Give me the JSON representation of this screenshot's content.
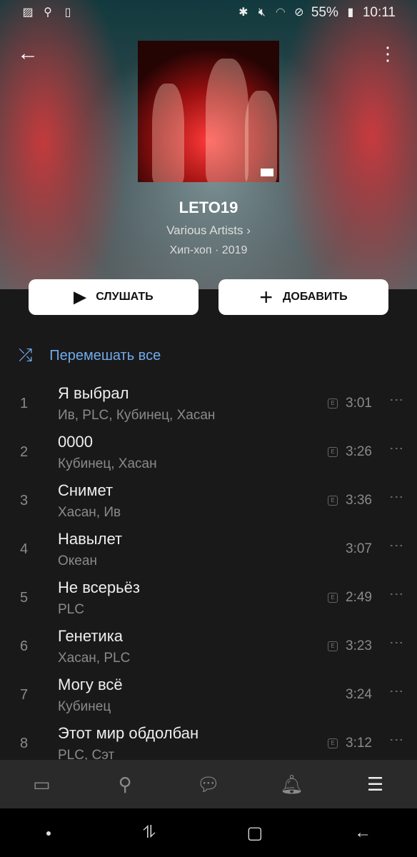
{
  "status": {
    "battery": "55%",
    "time": "10:11",
    "icons_left": [
      "gallery-icon",
      "search-icon",
      "screen-record-icon"
    ],
    "icons_right": [
      "bluetooth-icon",
      "mute-icon",
      "wifi-icon",
      "dnd-icon",
      "battery-icon"
    ]
  },
  "album": {
    "title": "LETO19",
    "artist": "Various Artists",
    "genre_year": "Хип-хоп · 2019"
  },
  "actions": {
    "play": "СЛУШАТЬ",
    "add": "ДОБАВИТЬ",
    "shuffle": "Перемешать все"
  },
  "colors": {
    "accent": "#71aaeb",
    "background": "#191919"
  },
  "tracks": [
    {
      "num": "1",
      "title": "Я выбрал",
      "artists": "Ив, PLC, Кубинец, Хасан",
      "explicit": true,
      "duration": "3:01"
    },
    {
      "num": "2",
      "title": "0000",
      "artists": "Кубинец, Хасан",
      "explicit": true,
      "duration": "3:26"
    },
    {
      "num": "3",
      "title": "Снимет",
      "artists": "Хасан, Ив",
      "explicit": true,
      "duration": "3:36"
    },
    {
      "num": "4",
      "title": "Навылет",
      "artists": "Океан",
      "explicit": false,
      "duration": "3:07"
    },
    {
      "num": "5",
      "title": "Не всерьёз",
      "artists": "PLC",
      "explicit": true,
      "duration": "2:49"
    },
    {
      "num": "6",
      "title": "Генетика",
      "artists": "Хасан, PLC",
      "explicit": true,
      "duration": "3:23"
    },
    {
      "num": "7",
      "title": "Могу всё",
      "artists": "Кубинец",
      "explicit": false,
      "duration": "3:24"
    },
    {
      "num": "8",
      "title": "Этот мир обдолбан",
      "artists": "PLC, Сэт",
      "explicit": true,
      "duration": "3:12"
    }
  ],
  "explicit_mark": "E",
  "tabbar": [
    "news-icon",
    "search-icon",
    "messages-icon",
    "notifications-icon",
    "menu-icon"
  ]
}
